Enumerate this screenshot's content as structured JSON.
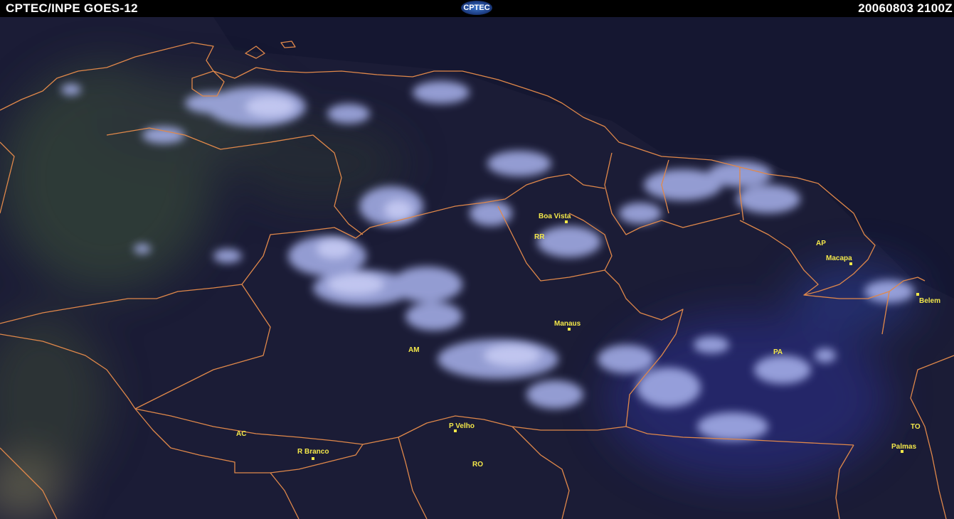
{
  "header": {
    "title": "CPTEC/INPE  GOES-12",
    "logo": "CPTEC",
    "timestamp": "20060803 2100Z"
  },
  "colors": {
    "background": "#1c1d3a",
    "cloud": "#a9b3ee",
    "border": "#e0884a",
    "label": "#f4e84a"
  },
  "cities": [
    {
      "name": "Boa Vista"
    },
    {
      "name": "Macapa"
    },
    {
      "name": "Belem"
    },
    {
      "name": "Manaus"
    },
    {
      "name": "P Velho"
    },
    {
      "name": "R Branco"
    },
    {
      "name": "Palmas"
    }
  ],
  "states": [
    {
      "name": "RR"
    },
    {
      "name": "AP"
    },
    {
      "name": "AM"
    },
    {
      "name": "PA"
    },
    {
      "name": "AC"
    },
    {
      "name": "RO"
    },
    {
      "name": "TO"
    }
  ]
}
